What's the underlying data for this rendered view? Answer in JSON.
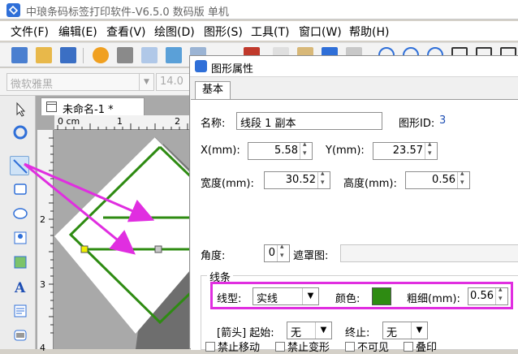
{
  "app": {
    "title": "中琅条码标签打印软件-V6.5.0 数码版 单机"
  },
  "menu": {
    "items": [
      "文件(F)",
      "编辑(E)",
      "查看(V)",
      "绘图(D)",
      "图形(S)",
      "工具(T)",
      "窗口(W)",
      "帮助(H)"
    ]
  },
  "fontbar": {
    "font_name": "微软雅黑",
    "font_size": "14.0"
  },
  "document": {
    "tab_label": "未命名-1 *",
    "ruler_h": [
      "0 cm",
      "1",
      "2"
    ],
    "ruler_v": [
      "2",
      "3",
      "4"
    ]
  },
  "dialog": {
    "title": "图形属性",
    "tab": "基本",
    "name_label": "名称:",
    "name_value": "线段 1 副本",
    "shape_id_label": "图形ID:",
    "shape_id_value": "3",
    "x_label": "X(mm):",
    "x_value": "5.58",
    "y_label": "Y(mm):",
    "y_value": "23.57",
    "width_label": "宽度(mm):",
    "width_value": "30.52",
    "height_label": "高度(mm):",
    "height_value": "0.56",
    "angle_label": "角度:",
    "angle_value": "0",
    "mask_label": "遮罩图:",
    "line_group_label": "线条",
    "line_type_label": "线型:",
    "line_type_value": "实线",
    "color_label": "颜色:",
    "line_color": "#2e8b12",
    "thickness_label": "粗细(mm):",
    "thickness_value": "0.56",
    "arrow_label": "[箭头] 起始:",
    "arrow_start_value": "无",
    "arrow_end_label": "终止:",
    "arrow_end_value": "无",
    "checkboxes": [
      "禁止移动",
      "禁止变形",
      "不可见",
      "叠印"
    ]
  },
  "colors": {
    "highlight": "#e02ee0",
    "shape_line": "#2e8b12",
    "accent": "#2f6fd8"
  }
}
